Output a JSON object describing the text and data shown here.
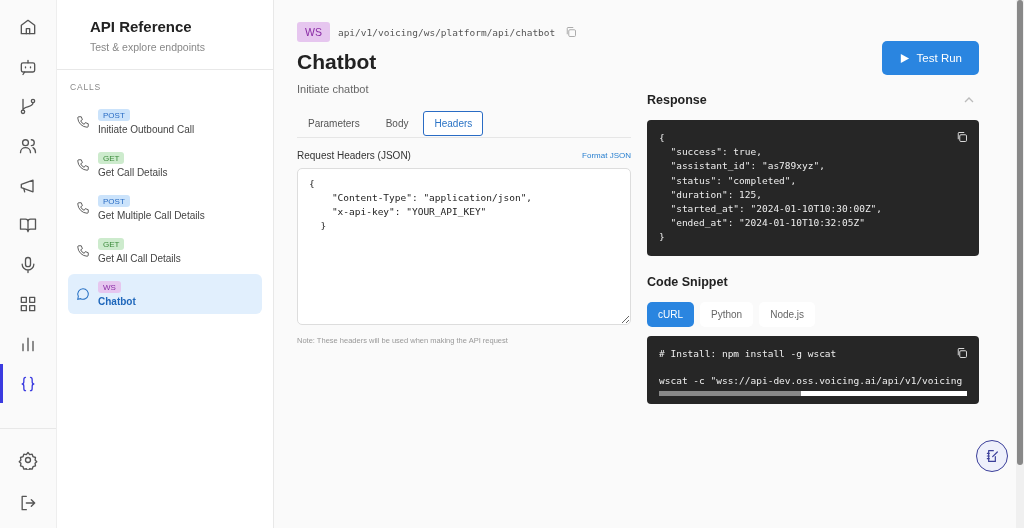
{
  "rail": {
    "top": [
      {
        "kind": "home",
        "selected": false
      },
      {
        "kind": "bot",
        "selected": false
      },
      {
        "kind": "branch",
        "selected": false
      },
      {
        "kind": "users",
        "selected": false
      },
      {
        "kind": "megaphone",
        "selected": false
      },
      {
        "kind": "book",
        "selected": false
      },
      {
        "kind": "mic",
        "selected": false
      },
      {
        "kind": "grid",
        "selected": false
      },
      {
        "kind": "chart",
        "selected": false
      },
      {
        "kind": "braces",
        "selected": true
      }
    ],
    "bottom": [
      {
        "kind": "gear",
        "selected": false
      },
      {
        "kind": "logout",
        "selected": false
      }
    ]
  },
  "sidebar": {
    "title": "API Reference",
    "subtitle": "Test & explore endpoints",
    "section": "CALLS",
    "items": [
      {
        "method": "POST",
        "label": "Initiate Outbound Call",
        "kind": "phone",
        "selected": false
      },
      {
        "method": "GET",
        "label": "Get Call Details",
        "kind": "phone",
        "selected": false
      },
      {
        "method": "POST",
        "label": "Get Multiple Call Details",
        "kind": "phone",
        "selected": false
      },
      {
        "method": "GET",
        "label": "Get All Call Details",
        "kind": "phone",
        "selected": false
      },
      {
        "method": "WS",
        "label": "Chatbot",
        "kind": "chat",
        "selected": true
      }
    ]
  },
  "endpoint": {
    "method": "WS",
    "path": "api/v1/voicing/ws/platform/api/chatbot",
    "title": "Chatbot",
    "description": "Initiate chatbot",
    "run_button": "Test Run"
  },
  "tabs": [
    {
      "label": "Parameters",
      "selected": false
    },
    {
      "label": "Body",
      "selected": false
    },
    {
      "label": "Headers",
      "selected": true
    }
  ],
  "headers": {
    "label": "Request Headers (JSON)",
    "format_link": "Format JSON",
    "value": "{\n    \"Content-Type\": \"application/json\",\n    \"x-api-key\": \"YOUR_API_KEY\"\n  }",
    "note": "Note: These headers will be used when making the API request"
  },
  "response": {
    "title": "Response",
    "expanded": true,
    "lines": [
      "{",
      "  \"success\": true,",
      "  \"assistant_id\": \"as789xyz\",",
      "  \"status\": \"completed\",",
      "  \"duration\": 125,",
      "  \"started_at\": \"2024-01-10T10:30:00Z\",",
      "  \"ended_at\": \"2024-01-10T10:32:05Z\"",
      "}"
    ]
  },
  "snippet": {
    "title": "Code Snippet",
    "tabs": [
      {
        "label": "cURL",
        "selected": true
      },
      {
        "label": "Python",
        "selected": false
      },
      {
        "label": "Node.js",
        "selected": false
      }
    ],
    "lines": [
      "# Install: npm install -g wscat",
      "wscat -c \"wss://api-dev.oss.voicing.ai/api/v1/voicing"
    ]
  }
}
